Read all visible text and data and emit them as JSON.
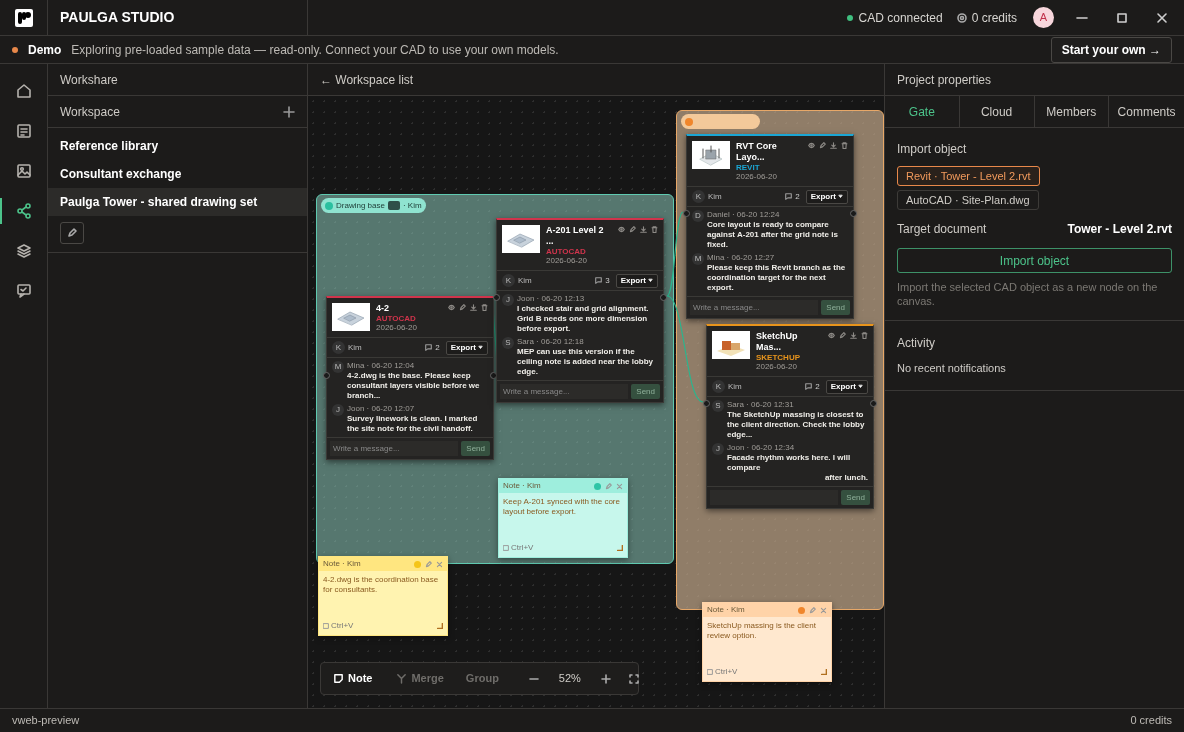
{
  "app": {
    "title": "PAULGA STUDIO",
    "cad_status": "CAD connected",
    "credits": "0 credits",
    "avatar": "A"
  },
  "demo_bar": {
    "badge": "Demo",
    "message": "Exploring pre-loaded sample data — read-only. Connect your CAD to use your own models.",
    "button": "Start your own →"
  },
  "nav": [
    {
      "selected": false
    },
    {
      "selected": false
    },
    {
      "selected": false
    },
    {
      "selected": true
    },
    {
      "selected": false
    },
    {
      "selected": false
    }
  ],
  "left_panel": {
    "title": "Workshare",
    "section": "Workspace",
    "items": [
      {
        "label": "Reference library",
        "selected": false
      },
      {
        "label": "Consultant exchange",
        "selected": false
      },
      {
        "label": "Paulga Tower - shared drawing set",
        "selected": true
      }
    ]
  },
  "canvas": {
    "back_link": "← Workspace list",
    "groups": [
      {
        "label": "Drawing base",
        "suffix": "· Kim",
        "color": "#5fc9b0"
      },
      {
        "color": "#e8a868"
      }
    ],
    "nodes": [
      {
        "kind": "plan",
        "title": "4-2",
        "type_label": "AUTOCAD",
        "color": "#d0344c",
        "date": "2026-06-20",
        "owner_initial": "K",
        "owner": "Kim",
        "comment_count": "2",
        "export": "Export",
        "messages": [
          {
            "initial": "M",
            "meta": "Mina · 06-20 12:04",
            "text": "4-2.dwg is the base. Please keep consultant layers visible before we branch..."
          },
          {
            "initial": "J",
            "meta": "Joon · 06-20 12:07",
            "text": "Survey linework is clean. I marked the site note for the civil handoff."
          }
        ],
        "placeholder": "Write a message...",
        "send": "Send"
      },
      {
        "kind": "plan",
        "title": "A-201 Level 2 ...",
        "type_label": "AUTOCAD",
        "color": "#d0344c",
        "date": "2026-06-20",
        "owner_initial": "K",
        "owner": "Kim",
        "comment_count": "3",
        "export": "Export",
        "messages": [
          {
            "initial": "J",
            "meta": "Joon · 06-20 12:13",
            "text": "I checked stair and grid alignment. Grid B needs one more dimension before export."
          },
          {
            "initial": "S",
            "meta": "Sara · 06-20 12:18",
            "text": "MEP can use this version if the ceiling note is added near the lobby edge."
          }
        ],
        "placeholder": "Write a message...",
        "send": "Send"
      },
      {
        "kind": "core",
        "title": "RVT Core Layo...",
        "type_label": "REVIT",
        "color": "#1ba6d4",
        "date": "2026-06-20",
        "owner_initial": "K",
        "owner": "Kim",
        "comment_count": "2",
        "export": "Export",
        "messages": [
          {
            "initial": "D",
            "meta": "Daniel · 06-20 12:24",
            "text": "Core layout is ready to compare against A-201 after the grid note is fixed."
          },
          {
            "initial": "M",
            "meta": "Mina · 06-20 12:27",
            "text": "Please keep this Revit branch as the coordination target for the next export."
          }
        ],
        "placeholder": "Write a message...",
        "send": "Send"
      },
      {
        "kind": "massing",
        "title": "SketchUp Mas...",
        "type_label": "SKETCHUP",
        "color": "#e8941c",
        "date": "2026-06-20",
        "owner_initial": "K",
        "owner": "Kim",
        "comment_count": "2",
        "export": "Export",
        "messages": [
          {
            "initial": "S",
            "meta": "Sara · 06-20 12:31",
            "text": "The SketchUp massing is closest to the client direction. Check the lobby edge..."
          },
          {
            "initial": "J",
            "meta": "Joon · 06-20 12:34",
            "text": "Facade rhythm works here. I will compare",
            "tail": "after lunch."
          }
        ],
        "send": "Send"
      }
    ],
    "notes": [
      {
        "header": "Note · Kim",
        "color": "#f5c518",
        "text": "4-2.dwg is the coordination base for consultants.",
        "shortcut": "Ctrl+V"
      },
      {
        "header": "Note · Kim",
        "color": "#2ec4a6",
        "text": "Keep A-201 synced with the core layout before export.",
        "shortcut": "Ctrl+V"
      },
      {
        "header": "Note · Kim",
        "color": "#f0862c",
        "text": "SketchUp massing is the client review option.",
        "shortcut": "Ctrl+V"
      }
    ],
    "toolbar": {
      "note": "Note",
      "merge": "Merge",
      "group": "Group",
      "zoom": "52%"
    }
  },
  "right_panel": {
    "title": "Project properties",
    "tabs": [
      {
        "label": "Gate",
        "selected": true
      },
      {
        "label": "Cloud",
        "selected": false
      },
      {
        "label": "Members",
        "selected": false
      },
      {
        "label": "Comments",
        "selected": false
      }
    ],
    "import_label": "Import object",
    "objects": [
      {
        "label": "Revit · Tower - Level 2.rvt",
        "selected": true
      },
      {
        "label": "AutoCAD · Site-Plan.dwg",
        "selected": false
      }
    ],
    "target_label": "Target document",
    "target_value": "Tower - Level 2.rvt",
    "import_button": "Import object",
    "hint": "Import the selected CAD object as a new node on the canvas.",
    "activity_title": "Activity",
    "activity_empty": "No recent notifications"
  },
  "status_bar": {
    "left": "vweb-preview",
    "right": "0 credits"
  }
}
